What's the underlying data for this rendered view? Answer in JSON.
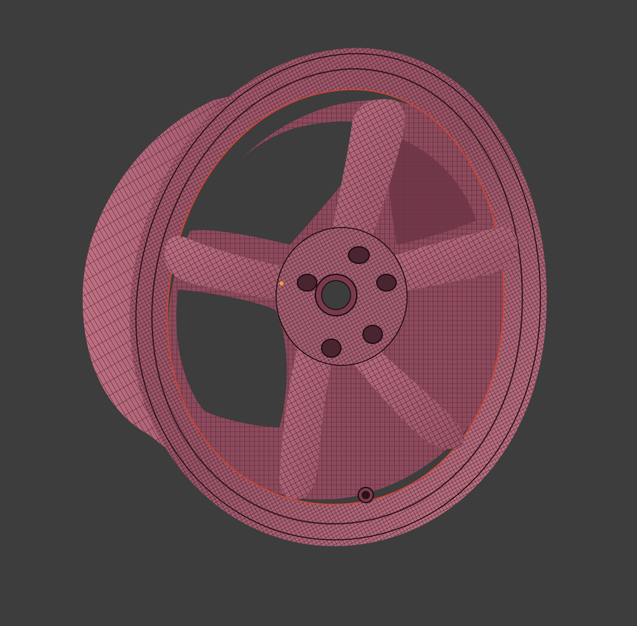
{
  "viewport": {
    "background": "#3d3d3d",
    "object": "wheel-rim-wireframe-model",
    "colors": {
      "surface_light": "#b8687a",
      "surface_mid": "#9a5467",
      "surface_dark": "#6a3344",
      "wire": "#241016",
      "edge_highlight": "#d4442f",
      "vertex_marker": "#f0a040"
    },
    "spokes": 5,
    "lug_holes": 5
  }
}
